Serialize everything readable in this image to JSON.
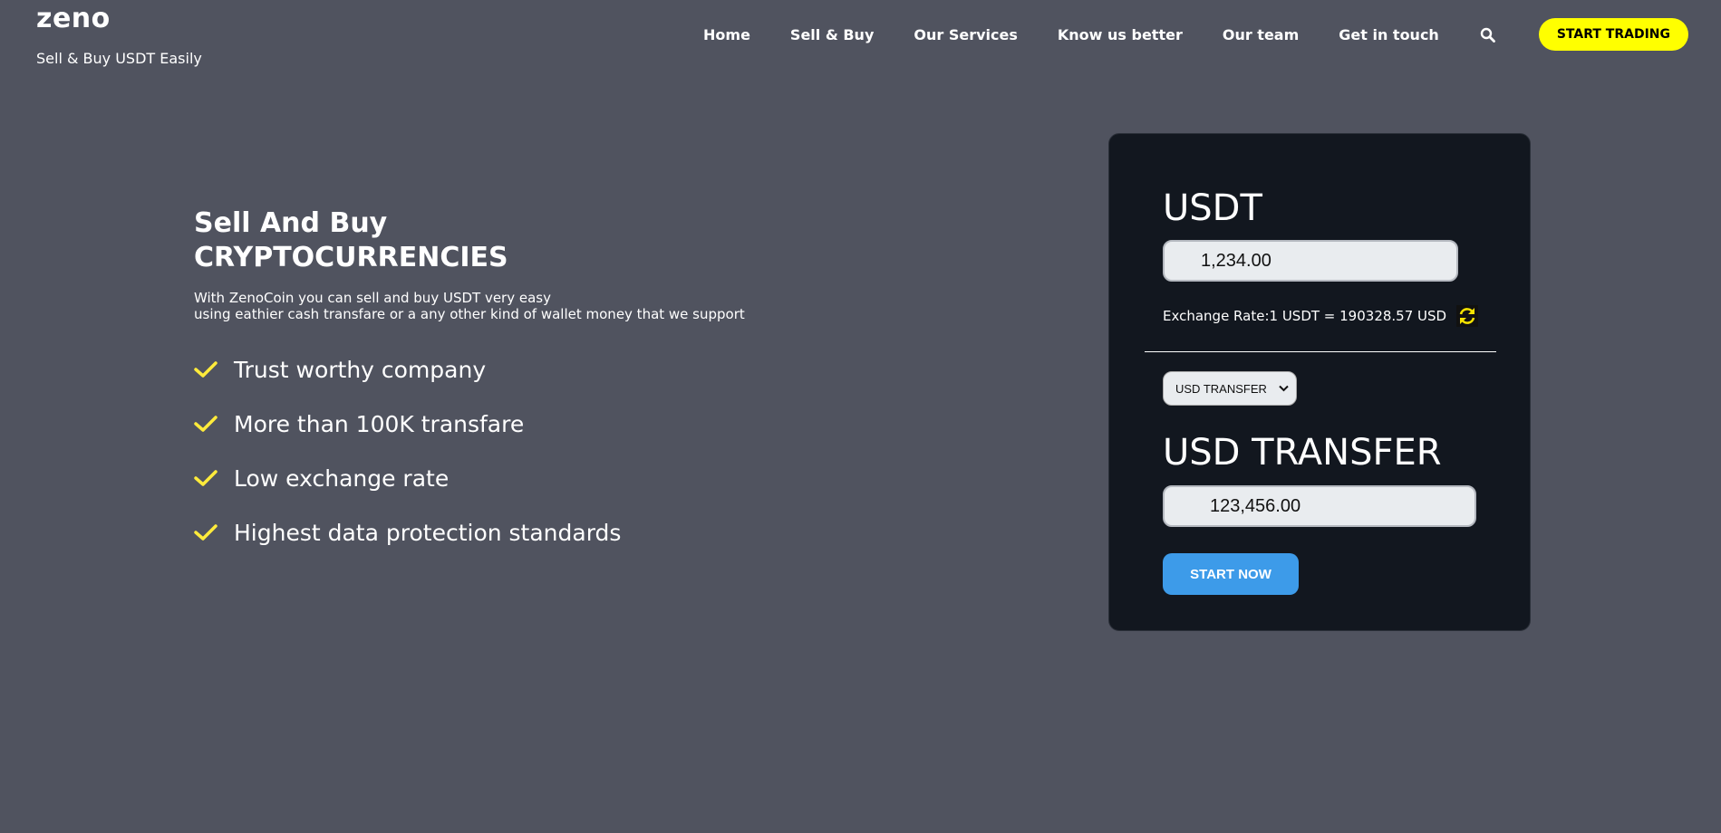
{
  "header": {
    "logo": "zeno",
    "tagline": "Sell & Buy USDT Easily",
    "nav": [
      "Home",
      "Sell & Buy",
      "Our Services",
      "Know us better",
      "Our team",
      "Get in touch"
    ],
    "search_icon": "search-icon",
    "cta_label": "START TRADING",
    "cta_color": "#ffff00"
  },
  "hero": {
    "title_line1": "Sell And Buy",
    "title_line2": "CRYPTOCURRENCIES",
    "desc_line1": "With ZenoCoin you can sell and buy USDT very easy",
    "desc_line2": "using eathier cash transfare or a any other kind of wallet money that we support",
    "features": [
      "Trust worthy company",
      "More than 100K transfare",
      "Low exchange rate",
      "Highest data protection standards"
    ],
    "check_icon": "check-icon",
    "check_color": "#ffeb3b"
  },
  "converter": {
    "from_currency": "USDT",
    "from_amount": "1,234.00",
    "exchange_rate": "Exchange Rate:1 USDT = 190328.57 USD",
    "refresh_icon": "refresh-icon",
    "select_value": "USD TRANSFER",
    "to_currency": "USD TRANSFER",
    "to_amount": "123,456.00",
    "submit_label": "START NOW",
    "card_color": "#12171f",
    "button_color": "#3d9be9"
  }
}
